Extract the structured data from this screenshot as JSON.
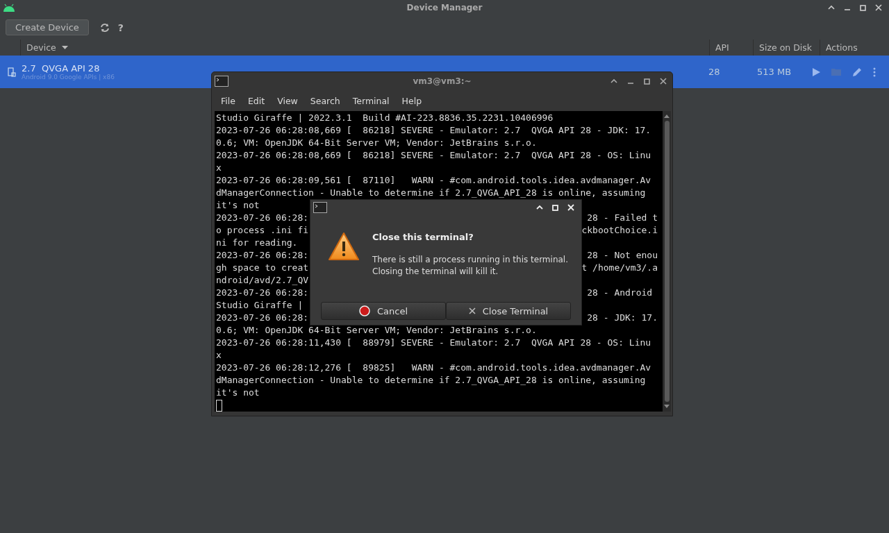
{
  "window": {
    "title": "Device Manager"
  },
  "toolbar": {
    "create_button": "Create Device",
    "help": "?"
  },
  "table": {
    "columns": [
      "Device",
      "API",
      "Size on Disk",
      "Actions"
    ],
    "rows": [
      {
        "name": "2.7  QVGA API 28",
        "subtitle": "Android 9.0 Google APIs | x86",
        "api": "28",
        "size": "513 MB",
        "selected": true
      }
    ]
  },
  "terminal": {
    "title": "vm3@vm3:~",
    "menu": [
      "File",
      "Edit",
      "View",
      "Search",
      "Terminal",
      "Help"
    ],
    "lines": [
      {
        "text": "Studio Giraffe | 2022.3.1  Build #AI-223.8836.35.2231.10406996"
      },
      {
        "text": "2023-07-26 06:28:08,669 [  86218] SEVERE - Emulator: 2.7  QVGA API 28 - JDK: 17."
      },
      {
        "text": "0.6; VM: OpenJDK 64-Bit Server VM; Vendor: JetBrains s.r.o."
      },
      {
        "text": "2023-07-26 06:28:08,669 [  86218] SEVERE - Emulator: 2.7  QVGA API 28 - OS: Linu"
      },
      {
        "text": "x"
      },
      {
        "text": "2023-07-26 06:28:09,561 [  87110]   WARN - #com.android.tools.idea.avdmanager.Av"
      },
      {
        "text": "dManagerConnection - Unable to determine if 2.7_QVGA_API_28 is online, assuming"
      },
      {
        "text": "it's not"
      },
      {
        "text": "2023-07-26 06:28:",
        "right": "28 - Failed t"
      },
      {
        "text": "o process .ini fi",
        "right": "ckbootChoice.i"
      },
      {
        "text": "ni for reading."
      },
      {
        "text": "2023-07-26 06:28:",
        "right": "28 - Not enou"
      },
      {
        "text": "gh space to creat",
        "right": "t /home/vm3/.a"
      },
      {
        "text": "ndroid/avd/2.7_QV"
      },
      {
        "text": "2023-07-26 06:28:",
        "right": "28 - Android "
      },
      {
        "text": "Studio Giraffe |"
      },
      {
        "text": "2023-07-26 06:28:",
        "right": "28 - JDK: 17."
      },
      {
        "text": "0.6; VM: OpenJDK 64-Bit Server VM; Vendor: JetBrains s.r.o."
      },
      {
        "text": "2023-07-26 06:28:11,430 [  88979] SEVERE - Emulator: 2.7  QVGA API 28 - OS: Linu"
      },
      {
        "text": "x"
      },
      {
        "text": "2023-07-26 06:28:12,276 [  89825]   WARN - #com.android.tools.idea.avdmanager.Av"
      },
      {
        "text": "dManagerConnection - Unable to determine if 2.7_QVGA_API_28 is online, assuming"
      },
      {
        "text": "it's not"
      }
    ]
  },
  "dialog": {
    "heading": "Close this terminal?",
    "message": [
      "There is still a process running in this terminal.",
      "Closing the terminal will kill it."
    ],
    "buttons": [
      {
        "label": "Cancel",
        "kind": "cancel"
      },
      {
        "label": "Close Terminal",
        "kind": "close"
      }
    ]
  }
}
